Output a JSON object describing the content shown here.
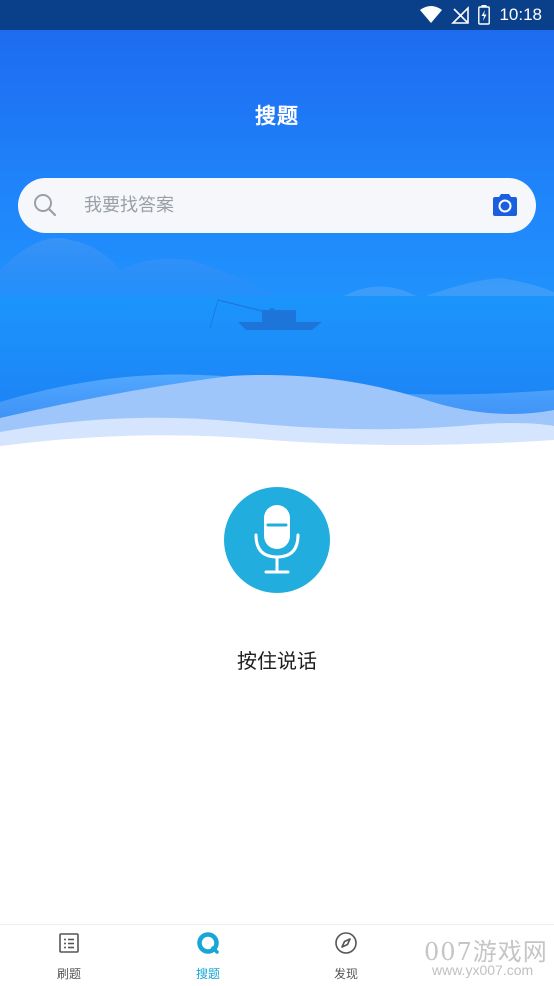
{
  "status_bar": {
    "time": "10:18",
    "icons": [
      "wifi-icon",
      "no-signal-icon",
      "battery-icon"
    ]
  },
  "header": {
    "title": "搜题"
  },
  "search": {
    "placeholder": "我要找答案",
    "value": "",
    "left_icon": "search-icon",
    "right_icon": "camera-icon"
  },
  "voice": {
    "icon": "microphone-icon",
    "label": "按住说话"
  },
  "bottom_nav": {
    "items": [
      {
        "label": "刷题",
        "icon": "list-icon",
        "active": false
      },
      {
        "label": "搜题",
        "icon": "search-circle-icon",
        "active": true
      },
      {
        "label": "发现",
        "icon": "compass-icon",
        "active": false
      }
    ]
  },
  "watermark": {
    "text": "007游戏网",
    "url": "www.yx007.com"
  },
  "colors": {
    "accent": "#17a7d6",
    "hero_top": "#1e6bf0",
    "hero_bottom": "#23a6ff",
    "search_bg": "#f5f7fa",
    "camera": "#1a5fe0"
  }
}
